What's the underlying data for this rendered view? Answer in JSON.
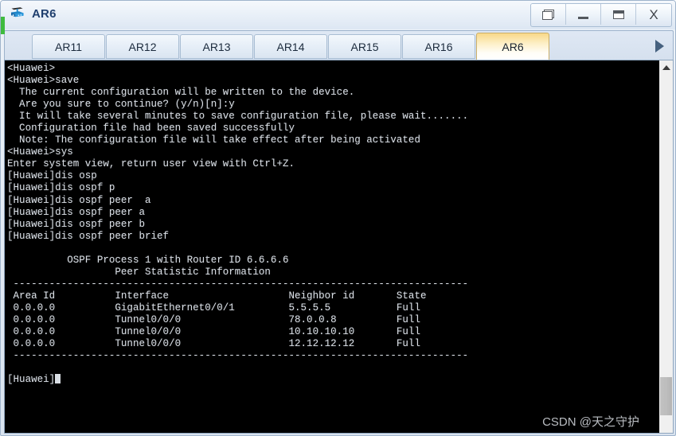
{
  "window": {
    "title": "AR6",
    "icon": "router-icon",
    "controls": [
      {
        "name": "restore-button",
        "label": "Restore",
        "icon": "restore-icon"
      },
      {
        "name": "minimize-button",
        "label": "Minimize",
        "icon": "minimize-icon"
      },
      {
        "name": "maximize-button",
        "label": "Maximize",
        "icon": "maximize-icon"
      },
      {
        "name": "close-button",
        "label": "X",
        "icon": "close-icon"
      }
    ]
  },
  "tabbar": {
    "scroll_left_icon": "triangle-left-icon",
    "scroll_right_icon": "triangle-right-icon",
    "tabs": [
      {
        "label": "AR11",
        "active": false
      },
      {
        "label": "AR12",
        "active": false
      },
      {
        "label": "AR13",
        "active": false
      },
      {
        "label": "AR14",
        "active": false
      },
      {
        "label": "AR15",
        "active": false
      },
      {
        "label": "AR16",
        "active": false
      },
      {
        "label": "AR6",
        "active": true
      }
    ],
    "active_tab": "AR6"
  },
  "terminal": {
    "prompt_user": "<Huawei>",
    "prompt_system": "[Huawei]",
    "cursor_visible": true,
    "lines": [
      "<Huawei>",
      "<Huawei>save",
      "  The current configuration will be written to the device.",
      "  Are you sure to continue? (y/n)[n]:y",
      "  It will take several minutes to save configuration file, please wait.......",
      "  Configuration file had been saved successfully",
      "  Note: The configuration file will take effect after being activated",
      "<Huawei>sys",
      "Enter system view, return user view with Ctrl+Z.",
      "[Huawei]dis osp",
      "[Huawei]dis ospf p",
      "[Huawei]dis ospf peer  a",
      "[Huawei]dis ospf peer a",
      "[Huawei]dis ospf peer b",
      "[Huawei]dis ospf peer brief",
      "",
      "\t  OSPF Process 1 with Router ID 6.6.6.6",
      "\t\t  Peer Statistic Information",
      " ----------------------------------------------------------------------------",
      " Area Id          Interface                    Neighbor id       State",
      " 0.0.0.0          GigabitEthernet0/0/1         5.5.5.5           Full",
      " 0.0.0.0          Tunnel0/0/0                  78.0.0.8          Full",
      " 0.0.0.0          Tunnel0/0/0                  10.10.10.10       Full",
      " 0.0.0.0          Tunnel0/0/0                  12.12.12.12       Full",
      " ----------------------------------------------------------------------------",
      "",
      "[Huawei]"
    ],
    "ospf": {
      "process_header": "OSPF Process 1 with Router ID 6.6.6.6",
      "subtitle": "Peer Statistic Information",
      "process_id": "1",
      "router_id": "6.6.6.6",
      "columns": [
        "Area Id",
        "Interface",
        "Neighbor id",
        "State"
      ],
      "rows": [
        {
          "area_id": "0.0.0.0",
          "interface": "GigabitEthernet0/0/1",
          "neighbor_id": "5.5.5.5",
          "state": "Full"
        },
        {
          "area_id": "0.0.0.0",
          "interface": "Tunnel0/0/0",
          "neighbor_id": "78.0.0.8",
          "state": "Full"
        },
        {
          "area_id": "0.0.0.0",
          "interface": "Tunnel0/0/0",
          "neighbor_id": "10.10.10.10",
          "state": "Full"
        },
        {
          "area_id": "0.0.0.0",
          "interface": "Tunnel0/0/0",
          "neighbor_id": "12.12.12.12",
          "state": "Full"
        }
      ]
    },
    "colors": {
      "background": "#000000",
      "text": "#d9dee4"
    }
  },
  "scrollbar": {
    "up_arrow_icon": "chevron-up-icon",
    "thumb_name": "scrollbar-thumb"
  },
  "watermark": {
    "text": "CSDN @天之守护"
  }
}
